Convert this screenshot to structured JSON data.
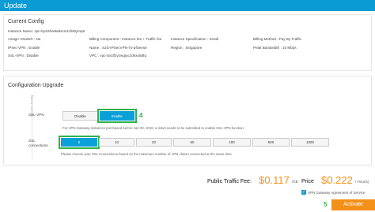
{
  "header": {
    "title": "Update"
  },
  "current_config": {
    "title": "Current Config",
    "instance_name": "Instance Name: vpn-bp19hw8a8xzm1dl49ymq6",
    "fields": [
      {
        "label": "Assign VSwitch : No"
      },
      {
        "label": "Billing Component : Instance fee + Traffic fee"
      },
      {
        "label": "Instance Specification : Small"
      },
      {
        "label": "Billing Method : Pay By Traffic"
      },
      {
        "label": "IPsec-VPN : Enable"
      },
      {
        "label": "Name : S2S-IPSecVPN-To-pfSense"
      },
      {
        "label": "Region : Singapore"
      },
      {
        "label": "Peak Bandwidth : 10 Mbps"
      },
      {
        "label": "SSL-VPN : Disable"
      },
      {
        "label": "VPC : vpc-t4n3fzvzwqtyczdexo58fq"
      }
    ]
  },
  "upgrade": {
    "title": "Configuration Upgrade",
    "side_label": "Function Config",
    "ssl_vpn_label": "SSL-VPN",
    "disable_label": "Disable",
    "enable_label": "Enable",
    "step_4": "4",
    "note1": "For VPN Gateway instances purchased before Jan 20, 2018, a ticket needs to be submitted to enable SSL-VPN function.",
    "ssl_conn_label": "SSL connections",
    "conn_options": [
      "5",
      "10",
      "20",
      "50",
      "100",
      "500",
      "1000"
    ],
    "selected_conn": "5",
    "note2": "Please choose your SSL Connections based on the maximum number of VPN clients connected at the same time"
  },
  "pricing": {
    "fee_label": "Public Traffic Fee:",
    "fee_value": "$0.117",
    "fee_unit": "/GB",
    "price_label": "Price",
    "price_value": "$0.222",
    "price_unit": "/ Hour(s)",
    "agreement": "VPN Gateway Agreement of Service",
    "step_5": "5",
    "activate_label": "Activate"
  },
  "colors": {
    "header": "#0a9ad4",
    "accent": "#f39019",
    "highlight": "#2fb24a",
    "selected": "#0aa0d8"
  }
}
